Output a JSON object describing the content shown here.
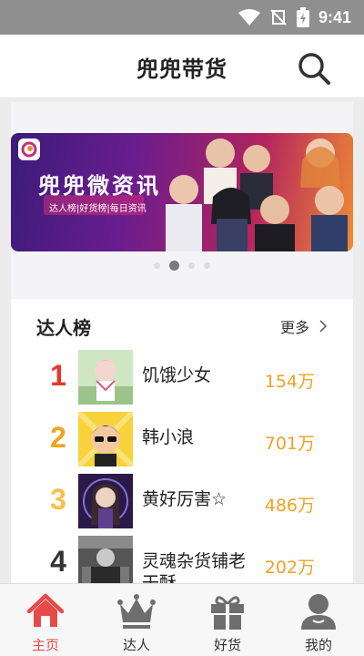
{
  "status": {
    "time": "9:41"
  },
  "header": {
    "title": "兜兜带货"
  },
  "banner": {
    "title": "兜兜微资讯",
    "subtitle": "达人榜|好货榜|每日资讯"
  },
  "section": {
    "title": "达人榜",
    "more_label": "更多"
  },
  "ranking": [
    {
      "rank": "1",
      "name": "饥饿少女",
      "count": "154万",
      "color": "#e8352b"
    },
    {
      "rank": "2",
      "name": "韩小浪",
      "count": "701万",
      "color": "#f2a31d"
    },
    {
      "rank": "3",
      "name": "黄好厉害☆",
      "count": "486万",
      "color": "#f5c04a"
    },
    {
      "rank": "4",
      "name": "灵魂杂货铺老干酥",
      "count": "202万",
      "color": "#333333"
    }
  ],
  "tabs": [
    {
      "label": "主页",
      "icon": "home-icon",
      "active": true
    },
    {
      "label": "达人",
      "icon": "crown-icon",
      "active": false
    },
    {
      "label": "好货",
      "icon": "gift-icon",
      "active": false
    },
    {
      "label": "我的",
      "icon": "user-icon",
      "active": false
    }
  ],
  "colors": {
    "accent": "#e84a4a",
    "count": "#f0a223"
  }
}
